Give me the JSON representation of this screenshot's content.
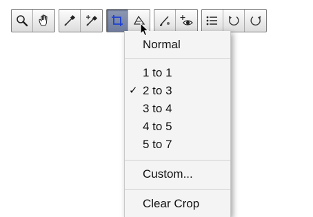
{
  "toolbar": {
    "groups": [
      {
        "tools": [
          {
            "icon": "zoom-icon"
          },
          {
            "icon": "hand-icon"
          }
        ]
      },
      {
        "tools": [
          {
            "icon": "eyedropper-icon"
          },
          {
            "icon": "eyedropper-plus-icon"
          }
        ]
      },
      {
        "tools": [
          {
            "icon": "crop-icon",
            "active": true
          },
          {
            "icon": "straighten-icon"
          }
        ]
      },
      {
        "tools": [
          {
            "icon": "retouch-brush-icon"
          },
          {
            "icon": "red-eye-icon"
          }
        ]
      },
      {
        "tools": [
          {
            "icon": "list-icon"
          },
          {
            "icon": "rotate-left-icon"
          },
          {
            "icon": "rotate-right-icon"
          }
        ]
      }
    ]
  },
  "menu": {
    "normal": "Normal",
    "ratios": [
      "1 to 1",
      "2 to 3",
      "3 to 4",
      "4 to 5",
      "5 to 7"
    ],
    "checked_item": "2 to 3",
    "check_mark": "✓",
    "custom": "Custom...",
    "clear_crop": "Clear Crop"
  },
  "colors": {
    "pressed_button": "#7a86a6",
    "menu_background": "#f4f4f4"
  }
}
